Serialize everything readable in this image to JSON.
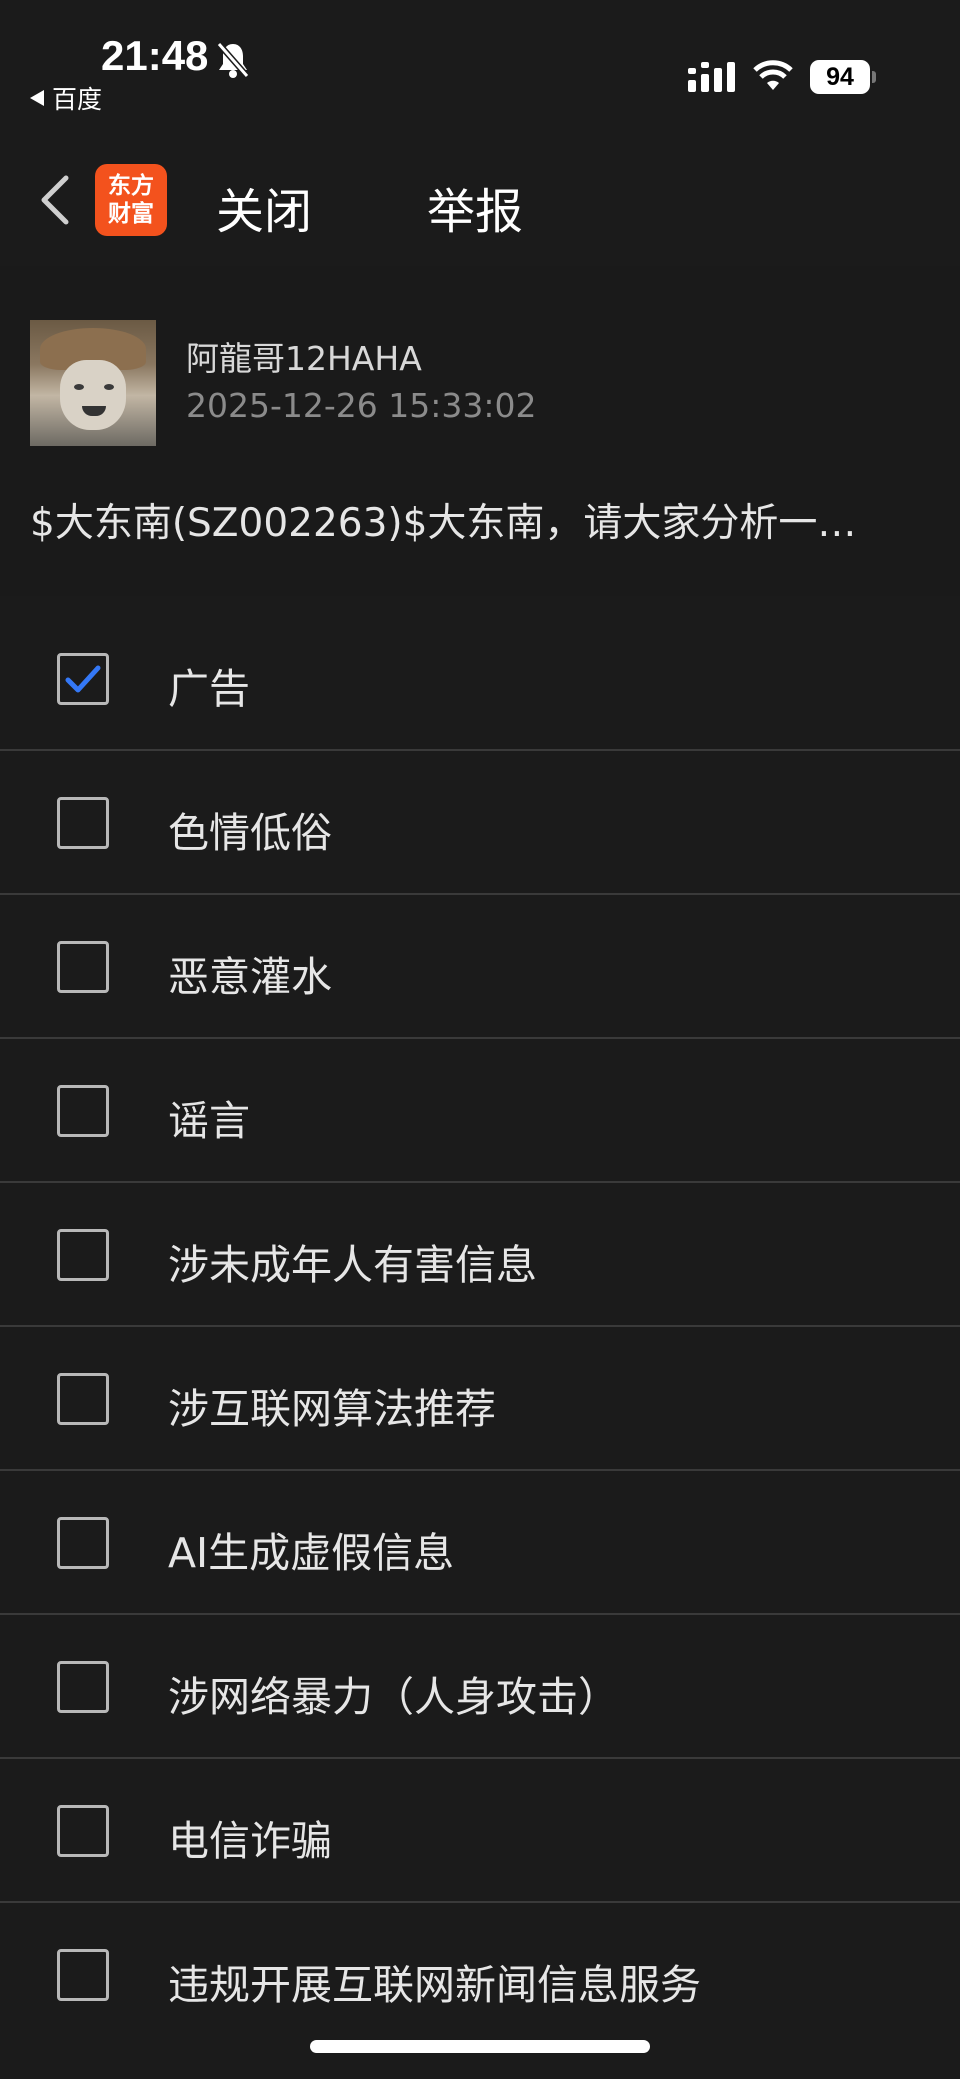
{
  "status_bar": {
    "time": "21:48",
    "back_app": "百度",
    "battery_level": "94",
    "icons": [
      "bell-slash-icon",
      "signal-icon",
      "wifi-icon",
      "battery-icon"
    ]
  },
  "nav": {
    "logo_line1": "东方",
    "logo_line2": "财富",
    "close_label": "关闭",
    "title": "举报"
  },
  "post": {
    "username": "阿龍哥12HAHA",
    "time": "2025-12-26 15:33:02",
    "content": "$大东南(SZ002263)$大东南，请大家分析一…"
  },
  "options": [
    {
      "label": "广告",
      "checked": true
    },
    {
      "label": "色情低俗",
      "checked": false
    },
    {
      "label": "恶意灌水",
      "checked": false
    },
    {
      "label": "谣言",
      "checked": false
    },
    {
      "label": "涉未成年人有害信息",
      "checked": false
    },
    {
      "label": "涉互联网算法推荐",
      "checked": false
    },
    {
      "label": "AI生成虚假信息",
      "checked": false
    },
    {
      "label": "涉网络暴力（人身攻击）",
      "checked": false
    },
    {
      "label": "电信诈骗",
      "checked": false
    },
    {
      "label": "违规开展互联网新闻信息服务",
      "checked": false
    }
  ],
  "colors": {
    "background": "#1b1b1b",
    "brand": "#f3521d",
    "check": "#3478f6",
    "divider": "#3a3a3a"
  }
}
